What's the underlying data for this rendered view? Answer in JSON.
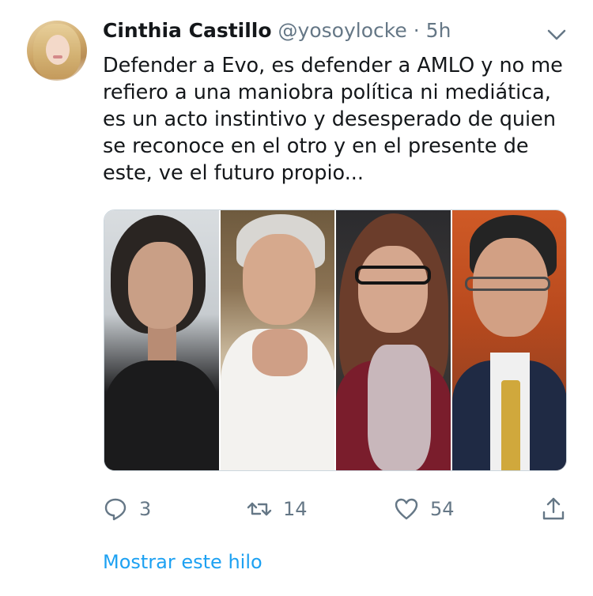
{
  "tweet": {
    "author_name": "Cinthia Castillo",
    "handle": "@yosoylocke",
    "separator": "·",
    "time": "5h",
    "text": "Defender a Evo, es defender a AMLO y no me refiero a una maniobra política ni mediática, es un acto instintivo y desesperado de quien se reconoce en el otro y en el presente de este, ve el futuro propio...",
    "media_count": 4
  },
  "actions": {
    "reply_icon": "reply-icon",
    "reply_count": "3",
    "retweet_icon": "retweet-icon",
    "retweet_count": "14",
    "like_icon": "heart-icon",
    "like_count": "54",
    "share_icon": "share-icon"
  },
  "thread_link": "Mostrar este hilo",
  "colors": {
    "text": "#14171a",
    "secondary": "#657786",
    "accent": "#1da1f2",
    "border": "#ccd6dd"
  }
}
